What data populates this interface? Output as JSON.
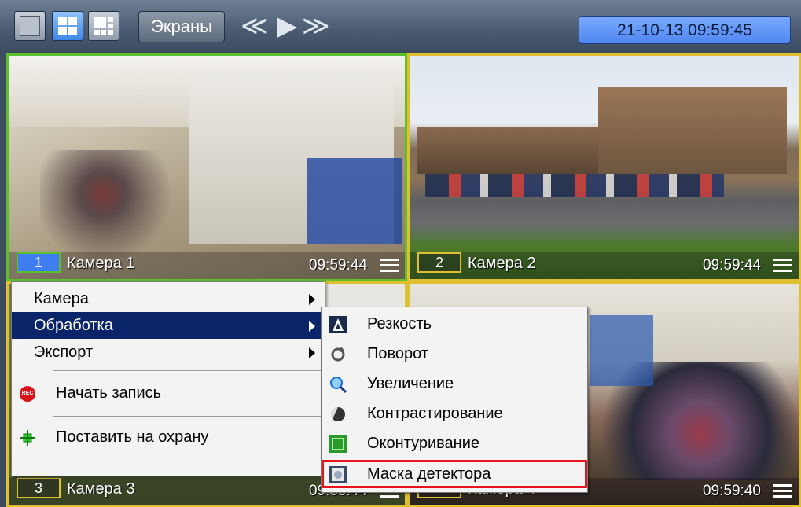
{
  "toolbar": {
    "screens_label": "Экраны",
    "nav_prev": "≪",
    "nav_play": "▶",
    "nav_next": "≫",
    "datetime": "21-10-13  09:59:45",
    "layout_buttons": [
      "single-view-icon",
      "grid-2x2-icon",
      "grid-custom-icon"
    ]
  },
  "cameras": [
    {
      "num": "1",
      "name": "Камера 1",
      "time": "09:59:44"
    },
    {
      "num": "2",
      "name": "Камера 2",
      "time": "09:59:44"
    },
    {
      "num": "3",
      "name": "Камера 3",
      "time": "09:59:44"
    },
    {
      "num": "4",
      "name": "Камера 4",
      "time": "09:59:40"
    }
  ],
  "context_menu": {
    "camera": "Камера",
    "processing": "Обработка",
    "export": "Экспорт",
    "start_recording": "Начать запись",
    "arm": "Поставить на охрану"
  },
  "submenu": {
    "items": [
      "Резкость",
      "Поворот",
      "Увеличение",
      "Контрастирование",
      "Оконтуривание",
      "Маска детектора"
    ]
  },
  "colors": {
    "highlight": "#0a246a",
    "selection_outline": "#e8141b",
    "active_tile_border": "#5ac02c",
    "tile_border": "#e0c030"
  }
}
